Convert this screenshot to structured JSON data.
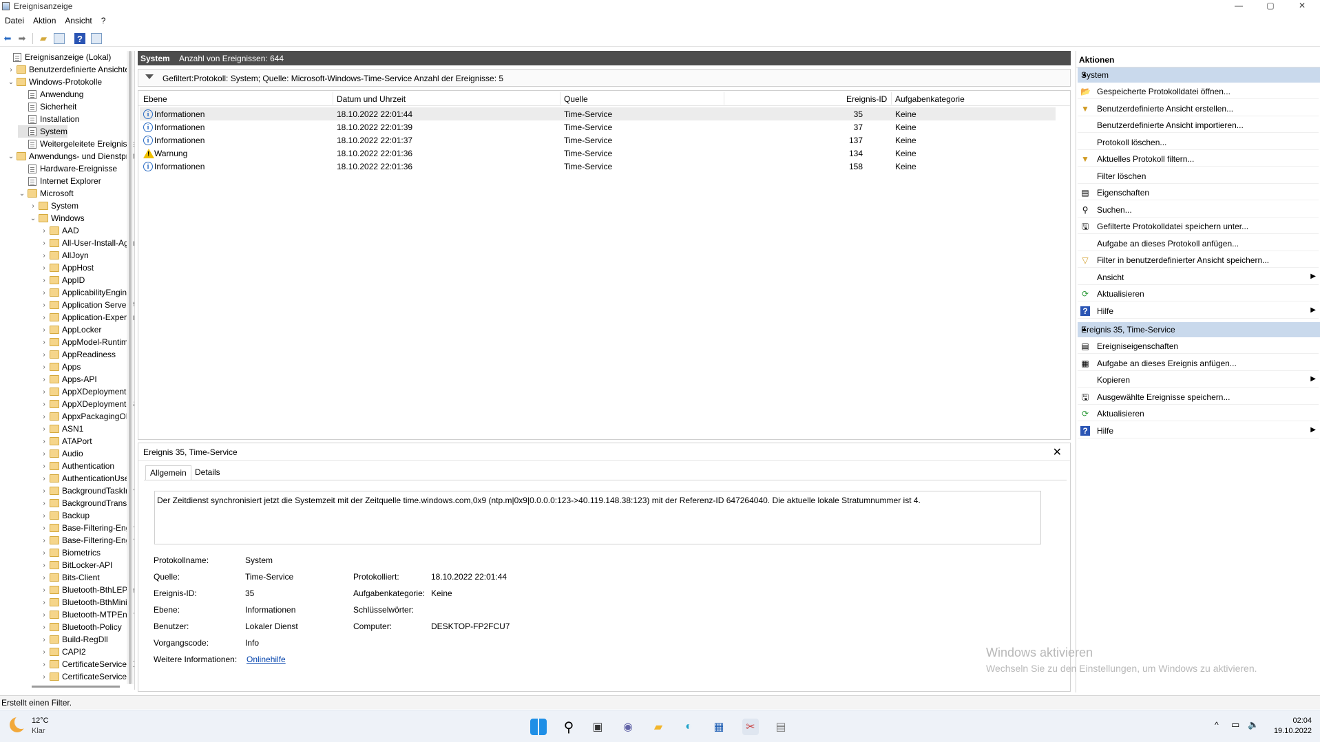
{
  "window": {
    "title": "Ereignisanzeige",
    "minimize": "—",
    "maximize": "▢",
    "close": "✕"
  },
  "menu": [
    "Datei",
    "Aktion",
    "Ansicht",
    "?"
  ],
  "toolbar": {
    "icons": [
      "back-icon",
      "forward-icon",
      "folder-up-icon",
      "console-tree-icon",
      "help-icon",
      "action-pane-icon"
    ]
  },
  "tree": {
    "items": [
      {
        "label": "Ereignisanzeige (Lokal)",
        "level": 0,
        "expand": "",
        "icon": "log"
      },
      {
        "label": "Benutzerdefinierte Ansichten",
        "level": 1,
        "expand": "›",
        "icon": "folder"
      },
      {
        "label": "Windows-Protokolle",
        "level": 1,
        "expand": "⌄",
        "icon": "folder"
      },
      {
        "label": "Anwendung",
        "level": 2,
        "expand": "",
        "icon": "log"
      },
      {
        "label": "Sicherheit",
        "level": 2,
        "expand": "",
        "icon": "log"
      },
      {
        "label": "Installation",
        "level": 2,
        "expand": "",
        "icon": "log"
      },
      {
        "label": "System",
        "level": 2,
        "expand": "",
        "icon": "log",
        "selected": true
      },
      {
        "label": "Weitergeleitete Ereignisse",
        "level": 2,
        "expand": "",
        "icon": "log"
      },
      {
        "label": "Anwendungs- und Dienstprotokolle",
        "level": 1,
        "expand": "⌄",
        "icon": "folder"
      },
      {
        "label": "Hardware-Ereignisse",
        "level": 2,
        "expand": "",
        "icon": "log"
      },
      {
        "label": "Internet Explorer",
        "level": 2,
        "expand": "",
        "icon": "log"
      },
      {
        "label": "Microsoft",
        "level": 2,
        "expand": "⌄",
        "icon": "folder"
      },
      {
        "label": "System",
        "level": 3,
        "expand": "›",
        "icon": "folder"
      },
      {
        "label": "Windows",
        "level": 3,
        "expand": "⌄",
        "icon": "folder"
      },
      {
        "label": "AAD",
        "level": 4,
        "expand": "›",
        "icon": "folder"
      },
      {
        "label": "All-User-Install-Agent",
        "level": 4,
        "expand": "›",
        "icon": "folder"
      },
      {
        "label": "AllJoyn",
        "level": 4,
        "expand": "›",
        "icon": "folder"
      },
      {
        "label": "AppHost",
        "level": 4,
        "expand": "›",
        "icon": "folder"
      },
      {
        "label": "AppID",
        "level": 4,
        "expand": "›",
        "icon": "folder"
      },
      {
        "label": "ApplicabilityEngine",
        "level": 4,
        "expand": "›",
        "icon": "folder"
      },
      {
        "label": "Application Server-Applications",
        "level": 4,
        "expand": "›",
        "icon": "folder"
      },
      {
        "label": "Application-Experience",
        "level": 4,
        "expand": "›",
        "icon": "folder"
      },
      {
        "label": "AppLocker",
        "level": 4,
        "expand": "›",
        "icon": "folder"
      },
      {
        "label": "AppModel-Runtime",
        "level": 4,
        "expand": "›",
        "icon": "folder"
      },
      {
        "label": "AppReadiness",
        "level": 4,
        "expand": "›",
        "icon": "folder"
      },
      {
        "label": "Apps",
        "level": 4,
        "expand": "›",
        "icon": "folder"
      },
      {
        "label": "Apps-API",
        "level": 4,
        "expand": "›",
        "icon": "folder"
      },
      {
        "label": "AppXDeployment",
        "level": 4,
        "expand": "›",
        "icon": "folder"
      },
      {
        "label": "AppXDeployment-Server",
        "level": 4,
        "expand": "›",
        "icon": "folder"
      },
      {
        "label": "AppxPackagingOM",
        "level": 4,
        "expand": "›",
        "icon": "folder"
      },
      {
        "label": "ASN1",
        "level": 4,
        "expand": "›",
        "icon": "folder"
      },
      {
        "label": "ATAPort",
        "level": 4,
        "expand": "›",
        "icon": "folder"
      },
      {
        "label": "Audio",
        "level": 4,
        "expand": "›",
        "icon": "folder"
      },
      {
        "label": "Authentication",
        "level": 4,
        "expand": "›",
        "icon": "folder"
      },
      {
        "label": "AuthenticationUser",
        "level": 4,
        "expand": "›",
        "icon": "folder"
      },
      {
        "label": "BackgroundTaskInfrastructure",
        "level": 4,
        "expand": "›",
        "icon": "folder"
      },
      {
        "label": "BackgroundTransfer",
        "level": 4,
        "expand": "›",
        "icon": "folder"
      },
      {
        "label": "Backup",
        "level": 4,
        "expand": "›",
        "icon": "folder"
      },
      {
        "label": "Base-Filtering-Engine-Connections",
        "level": 4,
        "expand": "›",
        "icon": "folder"
      },
      {
        "label": "Base-Filtering-Engine-Resource",
        "level": 4,
        "expand": "›",
        "icon": "folder"
      },
      {
        "label": "Biometrics",
        "level": 4,
        "expand": "›",
        "icon": "folder"
      },
      {
        "label": "BitLocker-API",
        "level": 4,
        "expand": "›",
        "icon": "folder"
      },
      {
        "label": "Bits-Client",
        "level": 4,
        "expand": "›",
        "icon": "folder"
      },
      {
        "label": "Bluetooth-BthLEPrepairing",
        "level": 4,
        "expand": "›",
        "icon": "folder"
      },
      {
        "label": "Bluetooth-BthMini",
        "level": 4,
        "expand": "›",
        "icon": "folder"
      },
      {
        "label": "Bluetooth-MTPEnum",
        "level": 4,
        "expand": "›",
        "icon": "folder"
      },
      {
        "label": "Bluetooth-Policy",
        "level": 4,
        "expand": "›",
        "icon": "folder"
      },
      {
        "label": "Build-RegDll",
        "level": 4,
        "expand": "›",
        "icon": "folder"
      },
      {
        "label": "CAPI2",
        "level": 4,
        "expand": "›",
        "icon": "folder"
      },
      {
        "label": "CertificateServicesClient",
        "level": 4,
        "expand": "›",
        "icon": "folder"
      },
      {
        "label": "CertificateServices",
        "level": 4,
        "expand": "›",
        "icon": "folder"
      }
    ]
  },
  "center": {
    "log_name": "System",
    "event_count": "Anzahl von Ereignissen: 644",
    "filter_text": "Gefiltert:Protokoll: System; Quelle: Microsoft-Windows-Time-Service Anzahl der Ereignisse: 5",
    "columns": [
      "Ebene",
      "Datum und Uhrzeit",
      "Quelle",
      "Ereignis-ID",
      "Aufgabenkategorie"
    ],
    "rows": [
      {
        "level": "Informationen",
        "type": "info",
        "date": "18.10.2022 22:01:44",
        "source": "Time-Service",
        "id": "35",
        "category": "Keine",
        "selected": true
      },
      {
        "level": "Informationen",
        "type": "info",
        "date": "18.10.2022 22:01:39",
        "source": "Time-Service",
        "id": "37",
        "category": "Keine"
      },
      {
        "level": "Informationen",
        "type": "info",
        "date": "18.10.2022 22:01:37",
        "source": "Time-Service",
        "id": "137",
        "category": "Keine"
      },
      {
        "level": "Warnung",
        "type": "warn",
        "date": "18.10.2022 22:01:36",
        "source": "Time-Service",
        "id": "134",
        "category": "Keine"
      },
      {
        "level": "Informationen",
        "type": "info",
        "date": "18.10.2022 22:01:36",
        "source": "Time-Service",
        "id": "158",
        "category": "Keine"
      }
    ]
  },
  "detail": {
    "title": "Ereignis 35, Time-Service",
    "close": "✕",
    "tabs": [
      "Allgemein",
      "Details"
    ],
    "message": "Der Zeitdienst synchronisiert jetzt die Systemzeit mit der Zeitquelle time.windows.com,0x9 (ntp.m|0x9|0.0.0.0:123->40.119.148.38:123) mit der Referenz-ID 647264040. Die aktuelle lokale Stratumnummer ist 4.",
    "fields": {
      "protokollname_label": "Protokollname:",
      "protokollname": "System",
      "quelle_label": "Quelle:",
      "quelle": "Time-Service",
      "protokolliert_label": "Protokolliert:",
      "protokolliert": "18.10.2022 22:01:44",
      "id_label": "Ereignis-ID:",
      "id": "35",
      "kategorie_label": "Aufgabenkategorie:",
      "kategorie": "Keine",
      "ebene_label": "Ebene:",
      "ebene": "Informationen",
      "schluessel_label": "Schlüsselwörter:",
      "benutzer_label": "Benutzer:",
      "benutzer": "Lokaler Dienst",
      "computer_label": "Computer:",
      "computer": "DESKTOP-FP2FCU7",
      "vorgang_label": "Vorgangscode:",
      "vorgang": "Info",
      "weitere_label": "Weitere Informationen:",
      "weitere_link": "Onlinehilfe"
    }
  },
  "actions": {
    "title": "Aktionen",
    "section1": {
      "title": "System",
      "items": [
        {
          "label": "Gespeicherte Protokolldatei öffnen...",
          "icon": "📂",
          "name": "open-saved-log-icon"
        },
        {
          "label": "Benutzerdefinierte Ansicht erstellen...",
          "icon": "▼",
          "name": "create-view-icon"
        },
        {
          "label": "Benutzerdefinierte Ansicht importieren...",
          "icon": "",
          "name": ""
        },
        {
          "label": "Protokoll löschen...",
          "icon": "",
          "name": ""
        },
        {
          "label": "Aktuelles Protokoll filtern...",
          "icon": "▼",
          "name": "filter-icon"
        },
        {
          "label": "Filter löschen",
          "icon": "",
          "name": ""
        },
        {
          "label": "Eigenschaften",
          "icon": "▤",
          "name": "properties-icon"
        },
        {
          "label": "Suchen...",
          "icon": "⚲",
          "name": "find-icon"
        },
        {
          "label": "Gefilterte Protokolldatei speichern unter...",
          "icon": "🖫",
          "name": "save-icon"
        },
        {
          "label": "Aufgabe an dieses Protokoll anfügen...",
          "icon": "",
          "name": ""
        },
        {
          "label": "Filter in benutzerdefinierter Ansicht speichern...",
          "icon": "▽",
          "name": "save-filter-icon"
        },
        {
          "label": "Ansicht",
          "icon": "",
          "name": "",
          "sub": "▶"
        },
        {
          "label": "Aktualisieren",
          "icon": "⟳",
          "name": "refresh-icon"
        },
        {
          "label": "Hilfe",
          "icon": "?",
          "name": "help-icon",
          "sub": "▶"
        }
      ]
    },
    "section2": {
      "title": "Ereignis 35, Time-Service",
      "items": [
        {
          "label": "Ereigniseigenschaften",
          "icon": "▤",
          "name": "event-properties-icon"
        },
        {
          "label": "Aufgabe an dieses Ereignis anfügen...",
          "icon": "▦",
          "name": "attach-task-icon"
        },
        {
          "label": "Kopieren",
          "icon": "",
          "name": "",
          "sub": "▶"
        },
        {
          "label": "Ausgewählte Ereignisse speichern...",
          "icon": "🖫",
          "name": "save-icon"
        },
        {
          "label": "Aktualisieren",
          "icon": "⟳",
          "name": "refresh-icon"
        },
        {
          "label": "Hilfe",
          "icon": "?",
          "name": "help-icon",
          "sub": "▶"
        }
      ]
    },
    "collapse": "▲"
  },
  "watermark": {
    "line1": "Windows aktivieren",
    "line2": "Wechseln Sie zu den Einstellungen, um Windows zu aktivieren."
  },
  "statusbar": "Erstellt einen Filter.",
  "taskbar": {
    "temp": "12°C",
    "condition": "Klar",
    "time": "02:04",
    "date": "19.10.2022",
    "tray_chevron": "^"
  },
  "colors": {
    "section_header": "#c9d9ec",
    "center_header": "#4d4d4d",
    "link": "#0645ad",
    "info": "#2b6cc4",
    "warning": "#f0c000"
  }
}
